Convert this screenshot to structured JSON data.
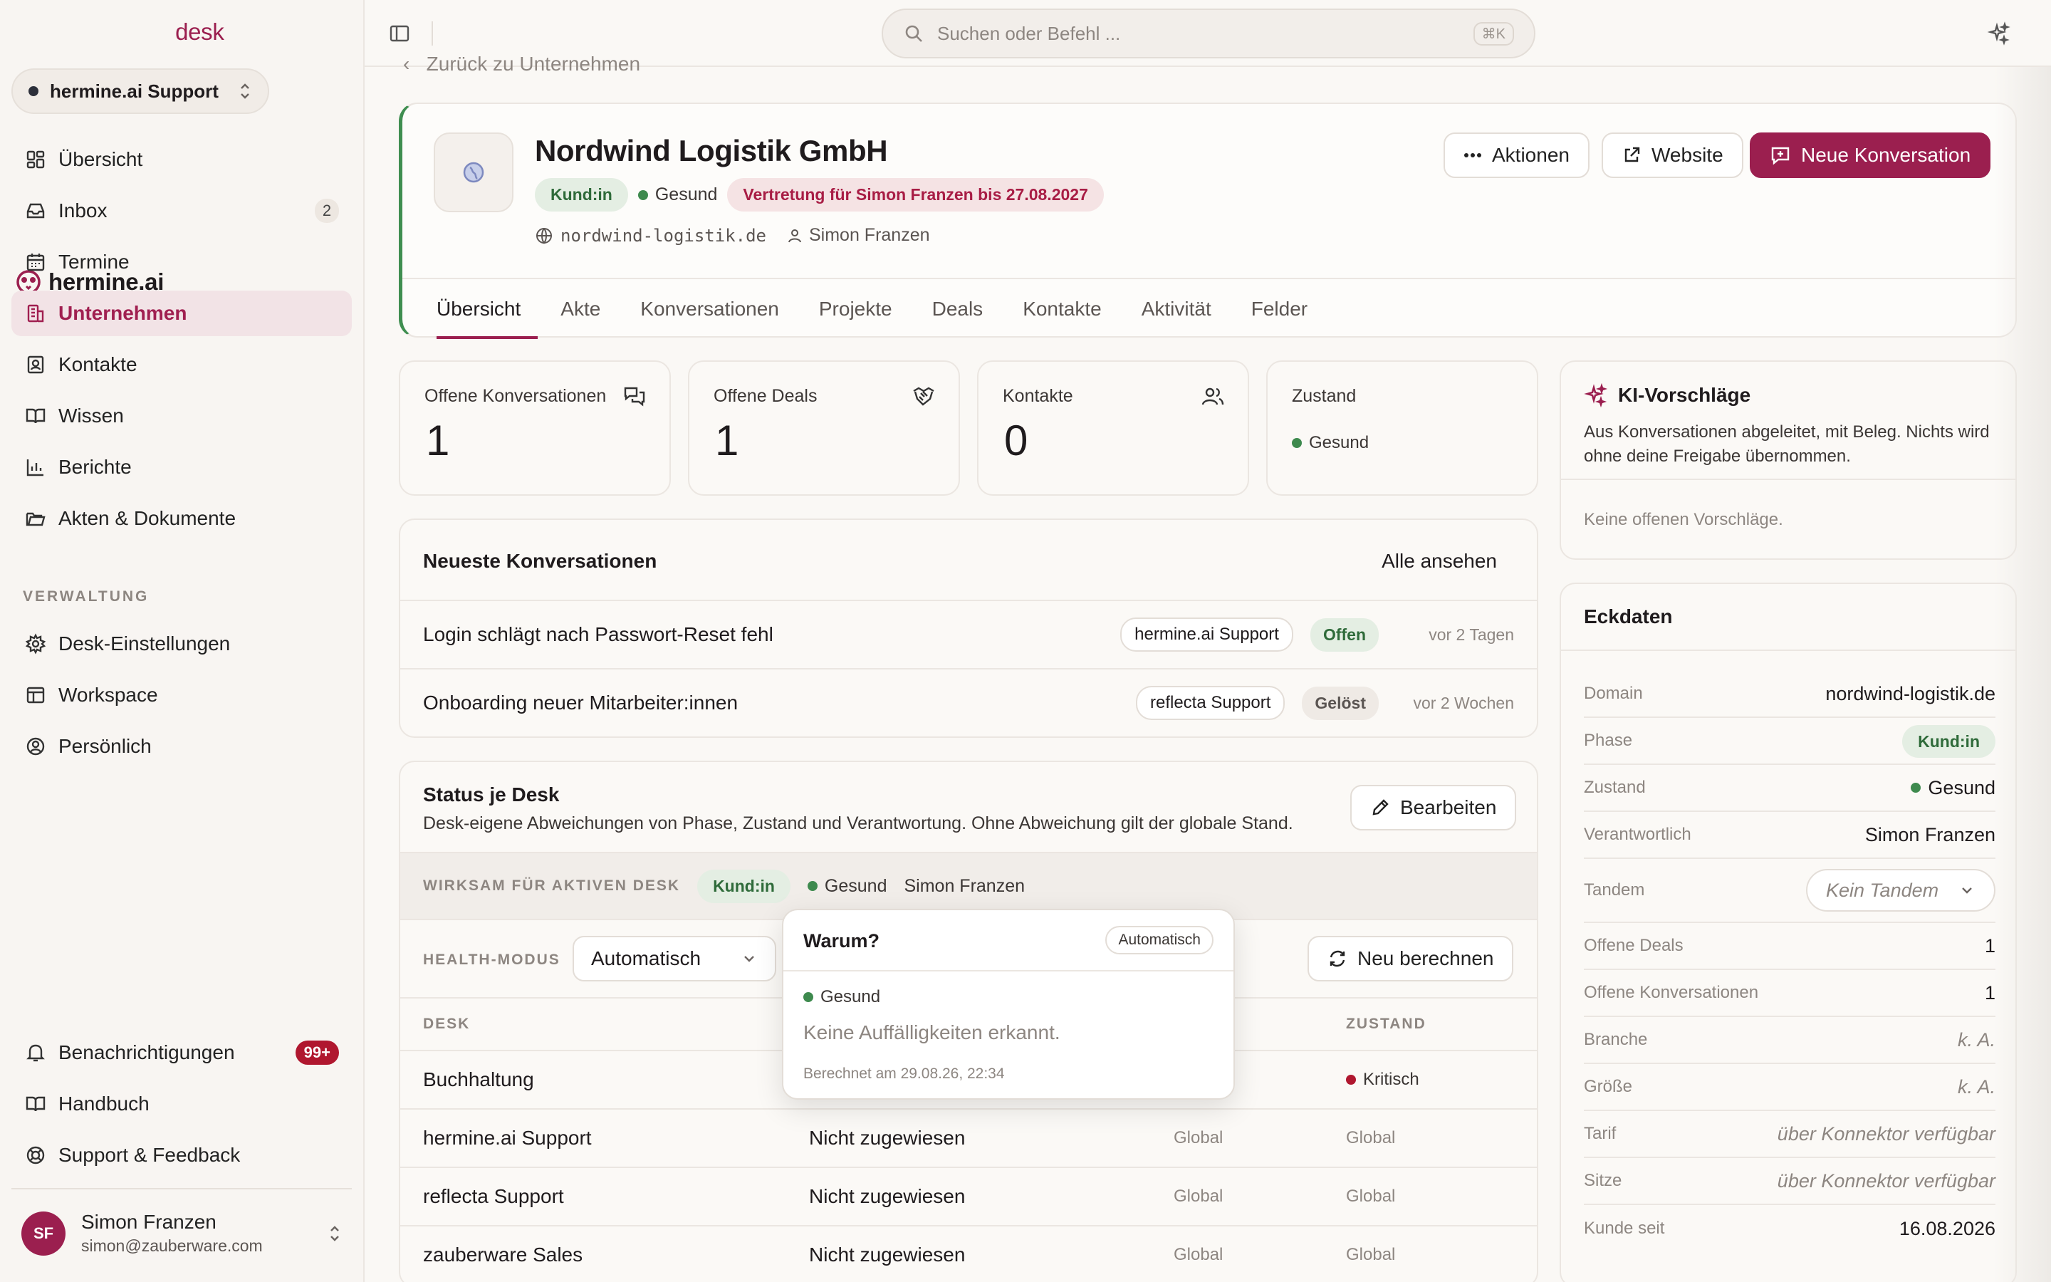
{
  "brand": {
    "name": "hermine.ai",
    "product": "desk"
  },
  "workspace": "hermine.ai Support",
  "nav": [
    {
      "label": "Übersicht",
      "icon": "dashboard-icon"
    },
    {
      "label": "Inbox",
      "icon": "inbox-icon",
      "count": "2"
    },
    {
      "label": "Termine",
      "icon": "calendar-icon"
    },
    {
      "label": "Unternehmen",
      "icon": "building-icon"
    },
    {
      "label": "Kontakte",
      "icon": "contact-icon"
    },
    {
      "label": "Wissen",
      "icon": "book-icon"
    },
    {
      "label": "Berichte",
      "icon": "bar-chart-icon"
    },
    {
      "label": "Akten & Dokumente",
      "icon": "folder-icon"
    }
  ],
  "section_admin": "VERWALTUNG",
  "admin_nav": [
    {
      "label": "Desk-Einstellungen",
      "icon": "gear-icon"
    },
    {
      "label": "Workspace",
      "icon": "layout-icon"
    },
    {
      "label": "Persönlich",
      "icon": "user-circle-icon"
    }
  ],
  "bottom_nav": [
    {
      "label": "Benachrichtigungen",
      "badge": "99+"
    },
    {
      "label": "Handbuch"
    },
    {
      "label": "Support & Feedback"
    }
  ],
  "user": {
    "initials": "SF",
    "name": "Simon Franzen",
    "email": "simon@zauberware.com"
  },
  "search": {
    "placeholder": "Suchen oder Befehl ...",
    "shortcut": "⌘K"
  },
  "back_link": "Zurück zu Unternehmen",
  "company": {
    "name": "Nordwind Logistik GmbH",
    "phase": "Kund:in",
    "health": "Gesund",
    "deputy": "Vertretung für Simon Franzen bis 27.08.2027",
    "domain": "nordwind-logistik.de",
    "owner": "Simon Franzen"
  },
  "actions": {
    "more": "Aktionen",
    "website": "Website",
    "new_conv": "Neue Konversation"
  },
  "tabs": [
    "Übersicht",
    "Akte",
    "Konversationen",
    "Projekte",
    "Deals",
    "Kontakte",
    "Aktivität",
    "Felder"
  ],
  "stats": [
    {
      "label": "Offene Konversationen",
      "value": "1"
    },
    {
      "label": "Offene Deals",
      "value": "1"
    },
    {
      "label": "Kontakte",
      "value": "0"
    },
    {
      "label": "Zustand",
      "value": "Gesund"
    }
  ],
  "ki": {
    "title": "KI-Vorschläge",
    "desc": "Aus Konversationen abgeleitet, mit Beleg. Nichts wird ohne deine Freigabe übernommen.",
    "empty": "Keine offenen Vorschläge."
  },
  "conversations": {
    "title": "Neueste Konversationen",
    "link": "Alle ansehen",
    "rows": [
      {
        "title": "Login schlägt nach Passwort-Reset fehl",
        "channel": "hermine.ai Support",
        "status": "Offen",
        "time": "vor 2 Tagen"
      },
      {
        "title": "Onboarding neuer Mitarbeiter:innen",
        "channel": "reflecta Support",
        "status": "Gelöst",
        "time": "vor 2 Wochen"
      }
    ]
  },
  "desk_status": {
    "title": "Status je Desk",
    "desc": "Desk-eigene Abweichungen von Phase, Zustand und Verantwortung. Ohne Abweichung gilt der globale Stand.",
    "edit": "Bearbeiten",
    "effective_label": "WIRKSAM FÜR AKTIVEN DESK",
    "effective_phase": "Kund:in",
    "effective_health": "Gesund",
    "effective_owner": "Simon Franzen",
    "mode_label": "HEALTH-MODUS",
    "mode_value": "Automatisch",
    "recalc": "Neu berechnen",
    "col_desk": "DESK",
    "col_state": "ZUSTAND",
    "rows": [
      {
        "desk": "Buchhaltung",
        "owner": "",
        "phase": "",
        "state": "Kritisch"
      },
      {
        "desk": "hermine.ai Support",
        "owner": "Nicht zugewiesen",
        "phase": "Global",
        "state": "Global"
      },
      {
        "desk": "reflecta Support",
        "owner": "Nicht zugewiesen",
        "phase": "Global",
        "state": "Global"
      },
      {
        "desk": "zauberware Sales",
        "owner": "Nicht zugewiesen",
        "phase": "Global",
        "state": "Global"
      }
    ]
  },
  "popover": {
    "title": "Warum?",
    "tag": "Automatisch",
    "health": "Gesund",
    "msg": "Keine Auffälligkeiten erkannt.",
    "calc": "Berechnet am 29.08.26, 22:34"
  },
  "eckdaten": {
    "title": "Eckdaten",
    "rows": [
      {
        "k": "Domain",
        "v": "nordwind-logistik.de"
      },
      {
        "k": "Phase",
        "v": "Kund:in"
      },
      {
        "k": "Zustand",
        "v": "Gesund"
      },
      {
        "k": "Verantwortlich",
        "v": "Simon Franzen"
      },
      {
        "k": "Tandem",
        "v": "Kein Tandem"
      },
      {
        "k": "Offene Deals",
        "v": "1"
      },
      {
        "k": "Offene Konversationen",
        "v": "1"
      },
      {
        "k": "Branche",
        "v": "k. A."
      },
      {
        "k": "Größe",
        "v": "k. A."
      },
      {
        "k": "Tarif",
        "v": "über Konnektor verfügbar"
      },
      {
        "k": "Sitze",
        "v": "über Konnektor verfügbar"
      },
      {
        "k": "Kunde seit",
        "v": "16.08.2026"
      }
    ]
  }
}
